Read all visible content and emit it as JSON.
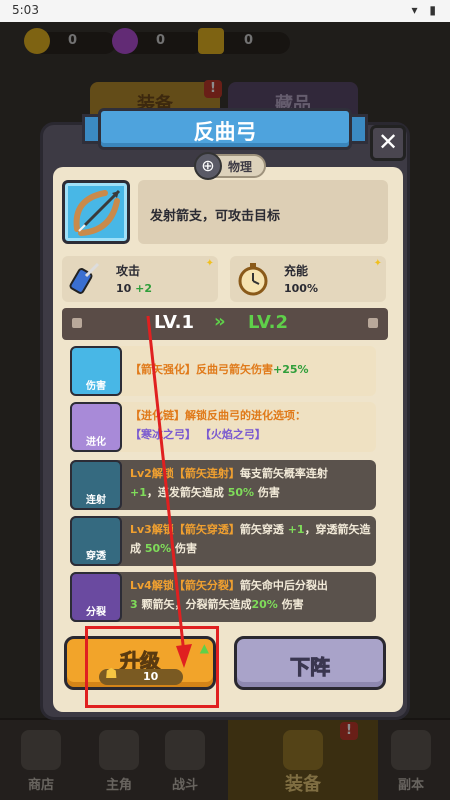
{
  "status_bar": {
    "time": "5:03",
    "icons": "▾ ▮"
  },
  "resources": [
    {
      "name": "gold",
      "value": "0",
      "color": "#e6b422"
    },
    {
      "name": "gem",
      "value": "0",
      "color": "#b24fd6"
    },
    {
      "name": "ticket",
      "value": "0",
      "color": "#e6b422"
    }
  ],
  "bg_tabs": {
    "equip": "装备",
    "collect": "藏品",
    "badge": "!"
  },
  "dialog": {
    "title": "反曲弓",
    "close": "✕",
    "type_label": "物理",
    "description": "发射箭支，可攻击目标",
    "stats": [
      {
        "label": "攻击",
        "value": "10",
        "plus": "+2",
        "icon": "arrow-quiver-icon",
        "color": "#3a6fd0"
      },
      {
        "label": "充能",
        "value": "100%",
        "plus": "",
        "icon": "stopwatch-icon",
        "color": "#e8a33a"
      }
    ],
    "level": {
      "from": "LV.1",
      "arrow": "»",
      "to": "LV.2"
    },
    "upgrades": [
      {
        "icon_label": "伤害",
        "parts": [
          "【箭矢强化】反曲弓箭矢伤害",
          "+25%"
        ]
      },
      {
        "icon_label": "进化",
        "parts": [
          "【进化链】解锁反曲弓的进化选项：",
          "【寒冰之弓】",
          "【火焰之弓】"
        ]
      },
      {
        "icon_label": "连射",
        "parts": [
          "Lv2解锁",
          "【箭矢连射】",
          "每支箭矢概率连射",
          "+1",
          "，连发箭矢造成",
          "50%",
          "伤害"
        ]
      },
      {
        "icon_label": "穿透",
        "parts": [
          "Lv3解锁",
          "【箭矢穿透】",
          "箭矢穿透",
          "+1",
          "，穿透箭矢造成",
          "50%",
          "伤害"
        ]
      },
      {
        "icon_label": "分裂",
        "parts": [
          "Lv4解锁",
          "【箭矢分裂】",
          "箭矢命中后分裂出",
          "3",
          "颗箭矢，分裂箭矢造成",
          "20%",
          "伤害"
        ]
      }
    ],
    "upgrade_button": {
      "label": "升级",
      "cost": "10"
    },
    "unequip_button": {
      "label": "下阵"
    }
  },
  "bottom_nav": [
    {
      "label": "商店",
      "icon": "shop-icon"
    },
    {
      "label": "主角",
      "icon": "helmet-icon"
    },
    {
      "label": "战斗",
      "icon": "swords-icon"
    },
    {
      "label": "装备",
      "icon": "backpack-icon",
      "active": true,
      "badge": "!"
    },
    {
      "label": "副本",
      "icon": "castle-icon"
    }
  ],
  "colors": {
    "accent_blue": "#4ea3dd",
    "upgrade_orange": "#f2a42a",
    "unequip_purple": "#a9a3c9",
    "green": "#5fd04a"
  }
}
